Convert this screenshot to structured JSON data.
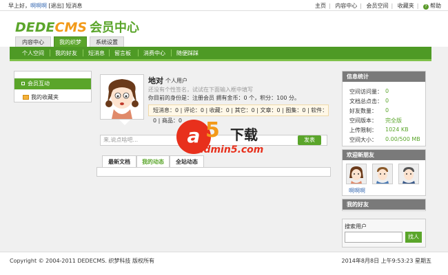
{
  "topbar": {
    "greeting": "早上好，",
    "username": "啊啊啊",
    "logout": "[退出]",
    "messages": "短消息",
    "links": [
      "主页",
      "内容中心",
      "会员空间",
      "收藏夹"
    ],
    "help": "帮助"
  },
  "header": {
    "logo_dede": "DEDE",
    "logo_cms": "CMS",
    "logo_hy": "会员中心",
    "tabs": [
      "内容中心",
      "我的织梦",
      "系统设置"
    ],
    "active_tab": 1
  },
  "subnav": {
    "items": [
      "个人空间",
      "我的好友",
      "短消息",
      "留言板",
      "消费中心",
      "随便踩踩"
    ]
  },
  "left": {
    "active_item": "会员互动",
    "fav_item": "我的收藏夹"
  },
  "profile": {
    "name": "地对",
    "role": "个人用户",
    "sign": "还没有个性签名，试试在下面输入框中填写",
    "identity": "你目前的身份是：注册会员 拥有金币：0 个，积分：100 分。",
    "stats": "短消息：0 | 评论：0 | 收藏：0 | 其它：0 | 文章：0 | 图集：0 | 软件：0 | 商品：0"
  },
  "composer": {
    "placeholder": "来,说点啥吧...",
    "send": "发表"
  },
  "feed_tabs": [
    "最新文档",
    "我的动态",
    "全站动态"
  ],
  "feed_active_tab": 1,
  "watermark": {
    "a": "a",
    "num": "5",
    "xz": "下载",
    "site": "admin5.com"
  },
  "sidebar": {
    "stats_title": "信息统计",
    "stats": [
      {
        "label": "空间访问量：",
        "value": "0"
      },
      {
        "label": "文档总点击：",
        "value": "0"
      },
      {
        "label": "好友数量：",
        "value": "0"
      },
      {
        "label": "空间版本：",
        "value": "完全版"
      },
      {
        "label": "上传限制：",
        "value": "1024 KB"
      },
      {
        "label": "空间大小：",
        "value": "0.00/500 MB"
      }
    ],
    "new_friends_title": "欢迎新朋友",
    "new_friend_name": "啊啊啊",
    "my_friends_title": "我的好友",
    "search_label": "搜索用户",
    "search_btn": "找人"
  },
  "footer": {
    "copyright": "Copyright © 2004-2011 DEDECMS. 织梦科技 版权所有",
    "datetime": "2014年8月8日 上午9:53:23 星期五"
  },
  "colors": {
    "accent": "#5aa52a",
    "orange": "#f29a1a",
    "header_gray": "#7a7a7a"
  }
}
